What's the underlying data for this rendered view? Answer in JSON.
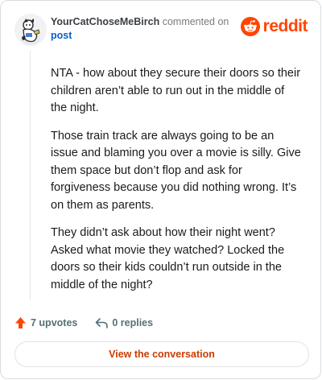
{
  "comment": {
    "username": "YourCatChoseMeBirch",
    "commented_on": "commented on",
    "post_link": "post",
    "paragraphs": [
      "NTA - how about they secure their doors so their children aren’t able to run out in the middle of the night.",
      "Those train track are always going to be an issue and blaming you over a movie is silly. Give them space but don’t flop and ask for forgiveness because you did nothing wrong. It’s on them as parents.",
      "They didn’t ask about how their night went? Asked what movie they watched? Locked the doors so their kids couldn’t run outside in the middle of the night?"
    ]
  },
  "brand": {
    "name": "reddit",
    "color": "#ff4500",
    "icon": "reddit-snoo-icon"
  },
  "actions": {
    "upvotes_label": "7 upvotes",
    "replies_label": "0 replies",
    "upvote_icon": "upvote-arrow-icon",
    "reply_icon": "reply-arrow-icon",
    "upvote_color": "#ff4500"
  },
  "footer": {
    "view_button_label": "View the conversation",
    "accent": "#c93c00"
  }
}
